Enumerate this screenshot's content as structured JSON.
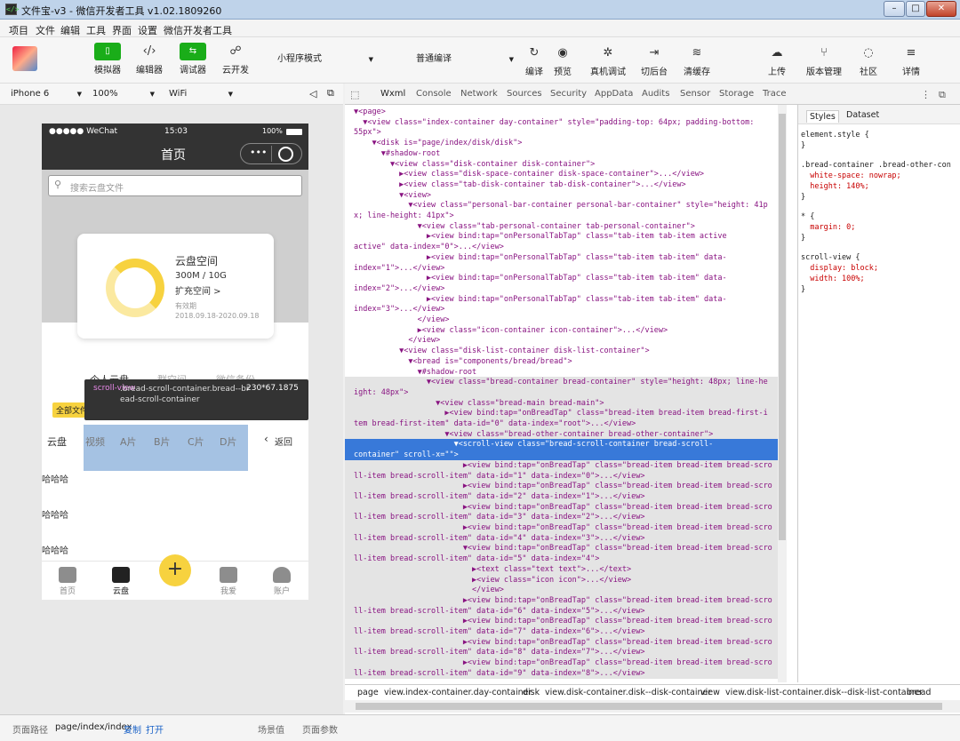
{
  "window": {
    "title": "文件宝-v3 - 微信开发者工具 v1.02.1809260"
  },
  "menu": [
    "项目",
    "文件",
    "编辑",
    "工具",
    "界面",
    "设置",
    "微信开发者工具"
  ],
  "toolbar": {
    "simulator": "模拟器",
    "editor": "编辑器",
    "debugger": "调试器",
    "cloud": "云开发",
    "mode": "小程序模式",
    "compile_mode": "普通编译",
    "compile": "编译",
    "preview": "预览",
    "real_debug": "真机调试",
    "switch_bg": "切后台",
    "clear_cache": "清缓存",
    "upload": "上传",
    "version": "版本管理",
    "community": "社区",
    "details": "详情"
  },
  "device": {
    "model": "iPhone 6",
    "zoom": "100%",
    "network": "WiFi"
  },
  "phone": {
    "status_carrier": "●●●●● WeChat",
    "status_time": "15:03",
    "status_battery": "100%",
    "nav_title": "首页",
    "search_placeholder": "搜索云盘文件",
    "card_title": "云盘空间",
    "card_usage": "300M / 10G",
    "card_expand": "扩充空间 >",
    "card_validity_label": "有效期",
    "card_validity": "2018.09.18-2020.09.18",
    "tabs": [
      "个人云盘",
      "群空间",
      "微信备份"
    ],
    "filter_chip": "全部文件",
    "crumbs": [
      "云盘",
      "视频",
      "A片",
      "B片",
      "C片",
      "D片"
    ],
    "back": "返回",
    "items": [
      "哈哈哈",
      "哈哈哈",
      "哈哈哈"
    ],
    "tabbar": [
      "首页",
      "云盘",
      "我爱",
      "账户"
    ]
  },
  "tooltip": {
    "tag": "scroll-view",
    "class": ".bread-scroll-container.bread--bread-scroll-container",
    "size": "230*67.1875"
  },
  "devtools": {
    "tabs": [
      "Wxml",
      "Console",
      "Network",
      "Sources",
      "Security",
      "AppData",
      "Audits",
      "Sensor",
      "Storage",
      "Trace"
    ],
    "style_tabs": [
      "Styles",
      "Dataset"
    ],
    "breadcrumb": [
      "page",
      "view.index-container.day-container",
      "disk",
      "view.disk-container.disk--disk-container",
      "view",
      "view.disk-list-container.disk--disk-list-container",
      "bread"
    ]
  },
  "tree": [
    "▼<page>",
    "  ▼<view class=\"index-container day-container\" style=\"padding-top: 64px; padding-bottom:",
    "55px\">",
    "    ▼<disk is=\"page/index/disk/disk\">",
    "      ▼#shadow-root",
    "        ▼<view class=\"disk-container disk-container\">",
    "          ▶<view class=\"disk-space-container disk-space-container\">...</view>",
    "          ▶<view class=\"tab-disk-container tab-disk-container\">...</view>",
    "          ▼<view>",
    "            ▼<view class=\"personal-bar-container personal-bar-container\" style=\"height: 41p",
    "x; line-height: 41px\">",
    "              ▼<view class=\"tab-personal-container tab-personal-container\">",
    "                ▶<view bind:tap=\"onPersonalTabTap\" class=\"tab-item tab-item active",
    "active\" data-index=\"0\">...</view>",
    "                ▶<view bind:tap=\"onPersonalTabTap\" class=\"tab-item tab-item\" data-",
    "index=\"1\">...</view>",
    "                ▶<view bind:tap=\"onPersonalTabTap\" class=\"tab-item tab-item\" data-",
    "index=\"2\">...</view>",
    "                ▶<view bind:tap=\"onPersonalTabTap\" class=\"tab-item tab-item\" data-",
    "index=\"3\">...</view>",
    "              </view>",
    "              ▶<view class=\"icon-container icon-container\">...</view>",
    "            </view>",
    "          ▼<view class=\"disk-list-container disk-list-container\">",
    "            ▼<bread is=\"components/bread/bread\">",
    "              ▼#shadow-root",
    "                ▼<view class=\"bread-container bread-container\" style=\"height: 48px; line-he",
    "ight: 48px\">",
    "                  ▼<view class=\"bread-main bread-main\">",
    "                    ▶<view bind:tap=\"onBreadTap\" class=\"bread-item bread-item bread-first-i",
    "tem bread-first-item\" data-id=\"0\" data-index=\"root\">...</view>",
    "                    ▼<view class=\"bread-other-container bread-other-container\">",
    "                      ▼<scroll-view class=\"bread-scroll-container bread-scroll-",
    "container\" scroll-x=\"\">",
    "                        ▶<view bind:tap=\"onBreadTap\" class=\"bread-item bread-item bread-scro",
    "ll-item bread-scroll-item\" data-id=\"1\" data-index=\"0\">...</view>",
    "                        ▶<view bind:tap=\"onBreadTap\" class=\"bread-item bread-item bread-scro",
    "ll-item bread-scroll-item\" data-id=\"2\" data-index=\"1\">...</view>",
    "                        ▶<view bind:tap=\"onBreadTap\" class=\"bread-item bread-item bread-scro",
    "ll-item bread-scroll-item\" data-id=\"3\" data-index=\"2\">...</view>",
    "                        ▶<view bind:tap=\"onBreadTap\" class=\"bread-item bread-item bread-scro",
    "ll-item bread-scroll-item\" data-id=\"4\" data-index=\"3\">...</view>",
    "                        ▼<view bind:tap=\"onBreadTap\" class=\"bread-item bread-item bread-scro",
    "ll-item bread-scroll-item\" data-id=\"5\" data-index=\"4\">",
    "                          ▶<text class=\"text text\">...</text>",
    "                          ▶<view class=\"icon icon\">...</view>",
    "                          </view>",
    "                        ▶<view bind:tap=\"onBreadTap\" class=\"bread-item bread-item bread-scro",
    "ll-item bread-scroll-item\" data-id=\"6\" data-index=\"5\">...</view>",
    "                        ▶<view bind:tap=\"onBreadTap\" class=\"bread-item bread-item bread-scro",
    "ll-item bread-scroll-item\" data-id=\"7\" data-index=\"6\">...</view>",
    "                        ▶<view bind:tap=\"onBreadTap\" class=\"bread-item bread-item bread-scro",
    "ll-item bread-scroll-item\" data-id=\"8\" data-index=\"7\">...</view>",
    "                        ▶<view bind:tap=\"onBreadTap\" class=\"bread-item bread-item bread-scro",
    "ll-item bread-scroll-item\" data-id=\"9\" data-index=\"8\">...</view>"
  ],
  "styles": [
    "element.style {",
    "}",
    ".bread-container .bread-other-con",
    "  white-space: nowrap;",
    "  height: 140%;",
    "}",
    "* {",
    "  margin: 0;",
    "}",
    "scroll-view {",
    "  display: block;",
    "  width: 100%;",
    "}"
  ],
  "statusbar": {
    "path_label": "页面路径",
    "path": "page/index/index",
    "copy": "复制",
    "open": "打开",
    "scene": "场景值",
    "params": "页面参数"
  },
  "colors": {
    "wechat_green": "#1aad19",
    "accent_yellow": "#f7d23f",
    "selection_blue": "#3879d9",
    "nav_dark": "#333333"
  }
}
